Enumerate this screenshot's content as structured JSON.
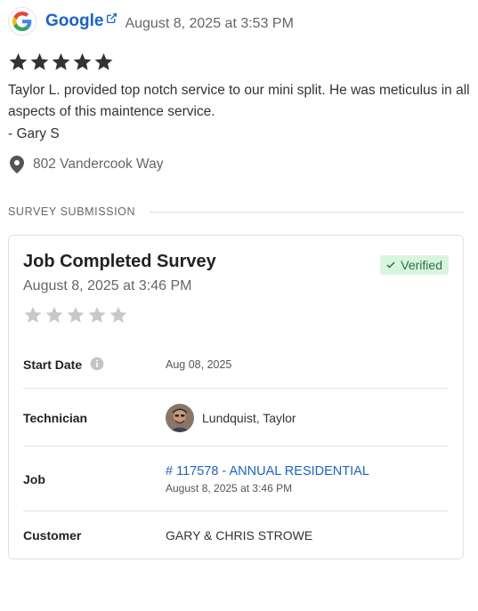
{
  "review": {
    "source": "Google",
    "date": "August 8, 2025 at 3:53 PM",
    "rating": 5,
    "text": "Taylor L. provided top notch service to our mini split. He was meticulus in all aspects of this maintence service.",
    "author": "- Gary S",
    "location": "802 Vandercook Way"
  },
  "section": {
    "label": "SURVEY SUBMISSION"
  },
  "survey": {
    "title": "Job Completed Survey",
    "date": "August 8, 2025 at 3:46 PM",
    "badge": "Verified",
    "rating": 0,
    "rows": {
      "start_date": {
        "label": "Start Date",
        "value": "Aug 08, 2025"
      },
      "technician": {
        "label": "Technician",
        "value": "Lundquist, Taylor"
      },
      "job": {
        "label": "Job",
        "link": "# 117578 - ANNUAL RESIDENTIAL",
        "sub": "August 8, 2025 at 3:46 PM"
      },
      "customer": {
        "label": "Customer",
        "value": "GARY & CHRIS STROWE"
      }
    }
  },
  "colors": {
    "link": "#1a63c9",
    "star_filled": "#333333",
    "star_empty": "#c8c8c8",
    "verified_bg": "#d8f5e0"
  },
  "icons": [
    "google-logo-icon",
    "external-link-icon",
    "star-icon",
    "map-pin-icon",
    "check-icon",
    "info-icon"
  ]
}
